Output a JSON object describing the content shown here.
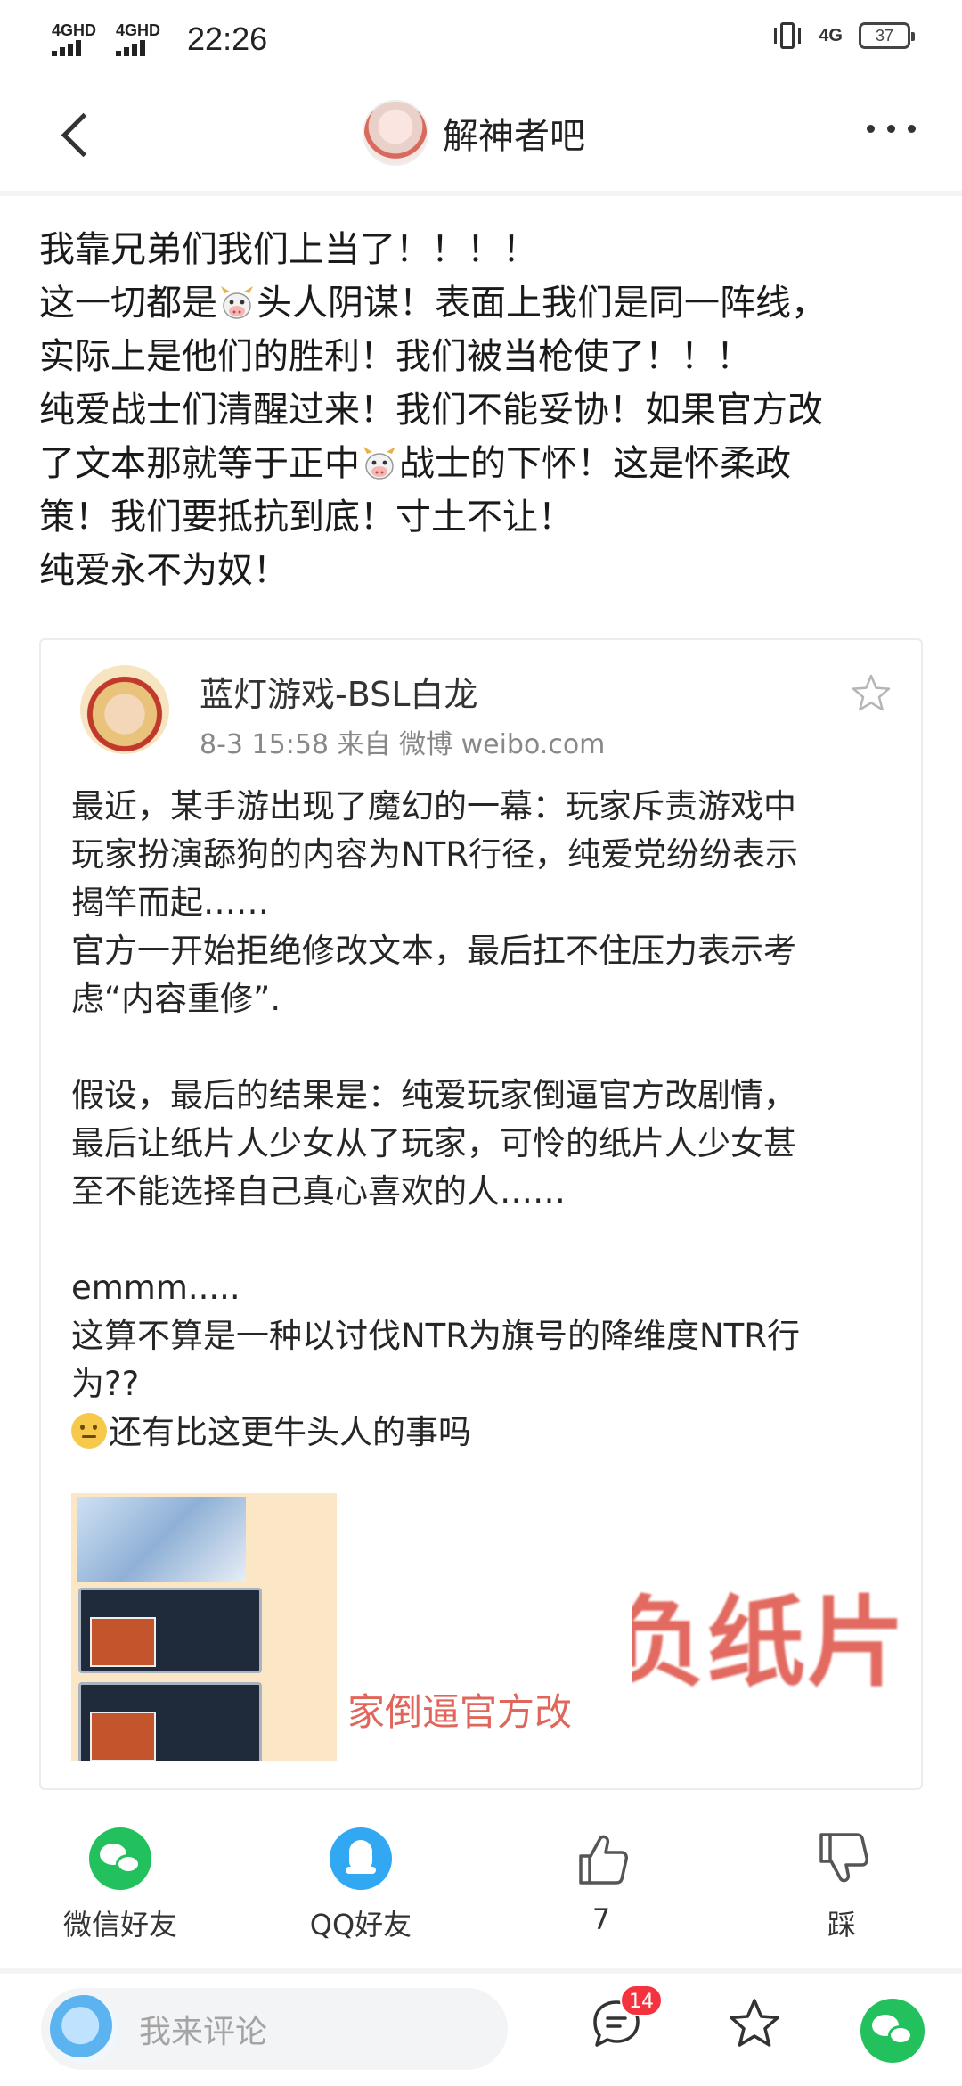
{
  "status_bar": {
    "sim1": "4GHD",
    "sim2": "4GHD",
    "time": "22:26",
    "network": "4G",
    "battery": "37"
  },
  "header": {
    "forum_name": "解神者吧"
  },
  "post": {
    "lines": [
      "我靠兄弟们我们上当了！！！！",
      "这一切都是",
      "头人阴谋！表面上我们是同一阵线，",
      "实际上是他们的胜利！我们被当枪使了！！！",
      "纯爱战士们清醒过来！我们不能妥协！如果官方改",
      "了文本那就等于正中",
      "战士的下怀！这是怀柔政",
      "策！我们要抵抗到底！寸土不让！",
      "纯爱永不为奴！"
    ]
  },
  "shared_card": {
    "author": "蓝灯游戏-BSL白龙",
    "meta": "8-3 15:58  来自 微博 weibo.com",
    "body": [
      "最近，某手游出现了魔幻的一幕：玩家斥责游戏中",
      "玩家扮演舔狗的内容为NTR行径，纯爱党纷纷表示",
      "揭竿而起……",
      "官方一开始拒绝修改文本，最后扛不住压力表示考",
      "虑“内容重修”.",
      "",
      "假设，最后的结果是：纯爱玩家倒逼官方改剧情，",
      "最后让纸片人少女从了玩家，可怜的纸片人少女甚",
      "至不能选择自己真心喜欢的人……",
      "",
      "emmm.....",
      "这算不算是一种以讨伐NTR为旗号的降维度NTR行",
      "为??",
      "还有比这更牛头人的事吗"
    ],
    "image_text_1": "家倒逼官方改",
    "image_text_2": "负纸片"
  },
  "actions": {
    "wechat": "微信好友",
    "qq": "QQ好友",
    "like_count": "7",
    "dislike": "踩"
  },
  "bottom_bar": {
    "comment_placeholder": "我来评论",
    "comment_badge": "14"
  },
  "colors": {
    "wechat_green": "#22c15e",
    "qq_blue": "#33a8f2",
    "badge_red": "#f5333f"
  }
}
